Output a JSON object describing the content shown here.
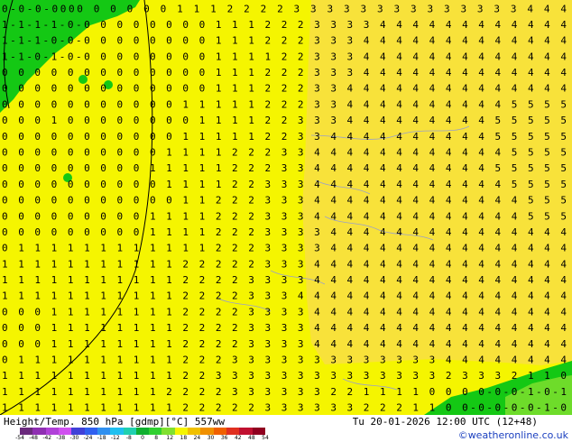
{
  "map": {
    "title": "Height/Temp. 850 hPa [gdmp][°C] 557ww",
    "valid_time": "Tu 20-01-2026 12:00 UTC (12+48)",
    "credit": "©weatheronline.co.uk",
    "fill_colors": {
      "yellow": "#f5f500",
      "gold": "#f8e23a",
      "green": "#14c814",
      "light_green": "#6edc2a"
    },
    "legend": {
      "ticks": [
        "-54",
        "-48",
        "-42",
        "-38",
        "-30",
        "-24",
        "-18",
        "-12",
        "-8",
        "0",
        "8",
        "12",
        "18",
        "24",
        "30",
        "36",
        "42",
        "48",
        "54"
      ],
      "colors": [
        "#6b2a7d",
        "#8f2fb2",
        "#b040d8",
        "#d050f0",
        "#4040d8",
        "#3060f0",
        "#3090f0",
        "#20c0f0",
        "#20d0b0",
        "#10b030",
        "#30d030",
        "#80e030",
        "#f5f500",
        "#f0c000",
        "#f09000",
        "#f06000",
        "#e03020",
        "#c01030",
        "#900020"
      ]
    },
    "rows": [
      "0-0-0-0000 0 0 0 0 0 1 1 1 2 2 2 2 3 3 3 3 3 3 3 3 3 3 3 3 3 3 4 4 4",
      "1-1-1-1-0-0 0 0 0 0 0 0 0 1 1 1 2 2 2 3 3 3 3 4 4 4 4 4 4 4 4 4 4 4 4",
      "1-1-1-0-0-0 0 0 0 0 0 0 0 1 1 1 2 2 2 3 3 3 4 4 4 4 4 4 4 4 4 4 4 4 4",
      "1-1-0-1-0-0 0 0 0 0 0 0 0 1 1 1 1 2 2 3 3 3 4 4 4 4 4 4 4 4 4 4 4 4 4",
      "0 0 0 0 0 0 0 0 0 0 0 0 0 1 1 1 2 2 2 3 3 3 4 4 4 4 4 4 4 4 4 4 4 4 4",
      "0 0 0 0 0 0 0 0 0 0 0 0 0 1 1 1 2 2 2 3 3 4 4 4 4 4 4 4 4 4 4 4 4 4 4",
      "0 0 0 0 0 0 0 0 0 0 0 1 1 1 1 1 2 2 2 3 3 4 4 4 4 4 4 4 4 4 4 5 5 5 5",
      "0 0 0 1 0 0 0 0 0 0 0 0 1 1 1 1 2 2 3 3 3 4 4 4 4 4 4 4 4 4 5 5 5 5 5",
      "0 0 0 0 0 0 0 0 0 0 0 1 1 1 1 1 2 2 3 3 4 4 4 4 4 4 4 4 4 4 5 5 5 5 5",
      "0 0 0 0 0 0 0 0 0 0 1 1 1 1 2 2 2 3 3 4 4 4 4 4 4 4 4 4 4 4 4 5 5 5 5",
      "0 0 0 0 0 0 0 0 0 1 1 1 1 1 2 2 2 3 3 4 4 4 4 4 4 4 4 4 4 4 5 5 5 5 5",
      "0 0 0 0 0 0 0 0 0 0 1 1 1 1 2 2 3 3 3 4 4 4 4 4 4 4 4 4 4 4 4 5 5 5 5",
      "0 0 0 0 0 0 0 0 0 0 0 1 1 2 2 2 3 3 3 4 4 4 4 4 4 4 4 4 4 4 4 4 5 5 5",
      "0 0 0 0 0 0 0 0 0 1 1 1 1 2 2 2 3 3 3 4 4 4 4 4 4 4 4 4 4 4 4 4 5 5 5",
      "0 0 0 0 0 0 0 0 0 1 1 1 1 2 2 2 3 3 3 3 4 4 4 4 4 4 4 4 4 4 4 4 4 4 4",
      "0 1 1 1 1 1 1 1 1 1 1 1 1 2 2 2 3 3 3 3 4 4 4 4 4 4 4 4 4 4 4 4 4 4 4",
      "1 1 1 1 1 1 1 1 1 1 1 2 2 2 2 2 3 3 3 4 4 4 4 4 4 4 4 4 4 4 4 4 4 4 4",
      "1 1 1 1 1 1 1 1 1 1 1 2 2 2 2 3 3 3 3 4 4 4 4 4 4 4 4 4 4 4 4 4 4 4 4",
      "1 1 1 1 1 1 1 1 1 1 1 2 2 2 2 3 3 3 4 4 4 4 4 4 4 4 4 4 4 4 4 4 4 4 4",
      "0 0 0 1 1 1 1 1 1 1 1 2 2 2 2 3 3 3 3 4 4 4 4 4 4 4 4 4 4 4 4 4 4 4 4",
      "0 0 0 1 1 1 1 1 1 1 1 2 2 2 2 3 3 3 3 4 4 4 4 4 4 4 4 4 4 4 4 4 4 4 4",
      "0 0 0 1 1 1 1 1 1 1 1 2 2 2 2 3 3 3 3 4 4 4 4 4 4 4 4 4 4 4 4 4 4 4 4",
      "0 1 1 1 1 1 1 1 1 1 1 2 2 2 3 3 3 3 3 3 3 3 3 3 3 3 3 4 4 4 4 4 4 4 4",
      "1 1 1 1 1 1 1 1 1 1 1 2 2 3 3 3 3 3 3 3 3 3 3 3 3 3 3 2 3 3 3 2 1 1 0",
      "1 1 1 1 1 1 1 1 1 1 2 2 2 2 3 3 3 3 3 3 2 2 1 1 1 1 0 0 0 0-0-0-1-0-1",
      "1 1 1 1 1 1 1 1 1 1 1 2 2 2 2 2 3 3 3 3 3 3 2 2 2 1 1 0 0-0-0-0-0-1-0"
    ]
  }
}
